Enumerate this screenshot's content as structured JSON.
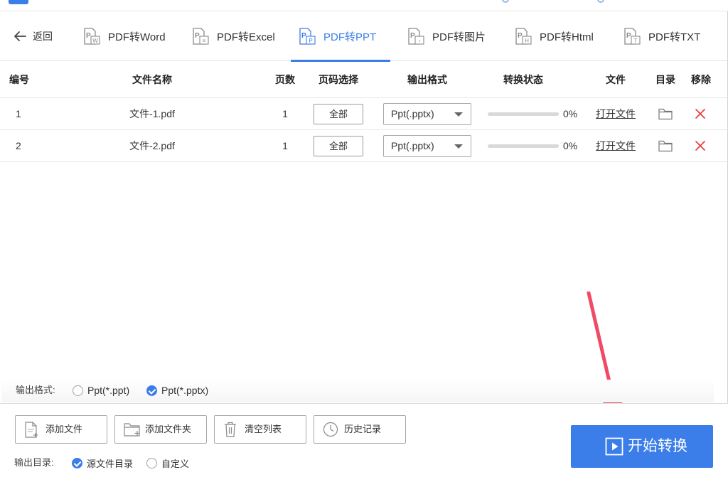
{
  "nav": {
    "back_label": "返回",
    "tabs": [
      {
        "label": "PDF转Word",
        "icon": "pdf-word-icon",
        "glyph": "W",
        "active": false
      },
      {
        "label": "PDF转Excel",
        "icon": "pdf-excel-icon",
        "glyph": "≡",
        "active": false
      },
      {
        "label": "PDF转PPT",
        "icon": "pdf-ppt-icon",
        "glyph": "P",
        "active": true
      },
      {
        "label": "PDF转图片",
        "icon": "pdf-image-icon",
        "glyph": "▫",
        "active": false
      },
      {
        "label": "PDF转Html",
        "icon": "pdf-html-icon",
        "glyph": "H",
        "active": false
      },
      {
        "label": "PDF转TXT",
        "icon": "pdf-txt-icon",
        "glyph": "T",
        "active": false
      }
    ]
  },
  "table": {
    "headers": {
      "index": "编号",
      "name": "文件名称",
      "pages": "页数",
      "page_select": "页码选择",
      "format": "输出格式",
      "status": "转换状态",
      "file": "文件",
      "dir": "目录",
      "remove": "移除"
    },
    "rows": [
      {
        "index": "1",
        "name": "文件-1.pdf",
        "pages": "1",
        "page_select": "全部",
        "format": "Ppt(.pptx)",
        "progress": 0,
        "status": "0%",
        "open": "打开文件"
      },
      {
        "index": "2",
        "name": "文件-2.pdf",
        "pages": "1",
        "page_select": "全部",
        "format": "Ppt(.pptx)",
        "progress": 0,
        "status": "0%",
        "open": "打开文件"
      }
    ]
  },
  "output_format": {
    "label": "输出格式:",
    "options": [
      {
        "label": "Ppt(*.ppt)",
        "checked": false
      },
      {
        "label": "Ppt(*.pptx)",
        "checked": true
      }
    ]
  },
  "actions": {
    "add_file": "添加文件",
    "add_folder": "添加文件夹",
    "clear_list": "清空列表",
    "history": "历史记录"
  },
  "output_dir": {
    "label": "输出目录:",
    "options": [
      {
        "label": "源文件目录",
        "checked": true
      },
      {
        "label": "自定义",
        "checked": false
      }
    ]
  },
  "start_button": "开始转换",
  "colors": {
    "accent": "#3b7de9",
    "remove": "#e53935",
    "annotation_arrow": "#f04a67"
  }
}
